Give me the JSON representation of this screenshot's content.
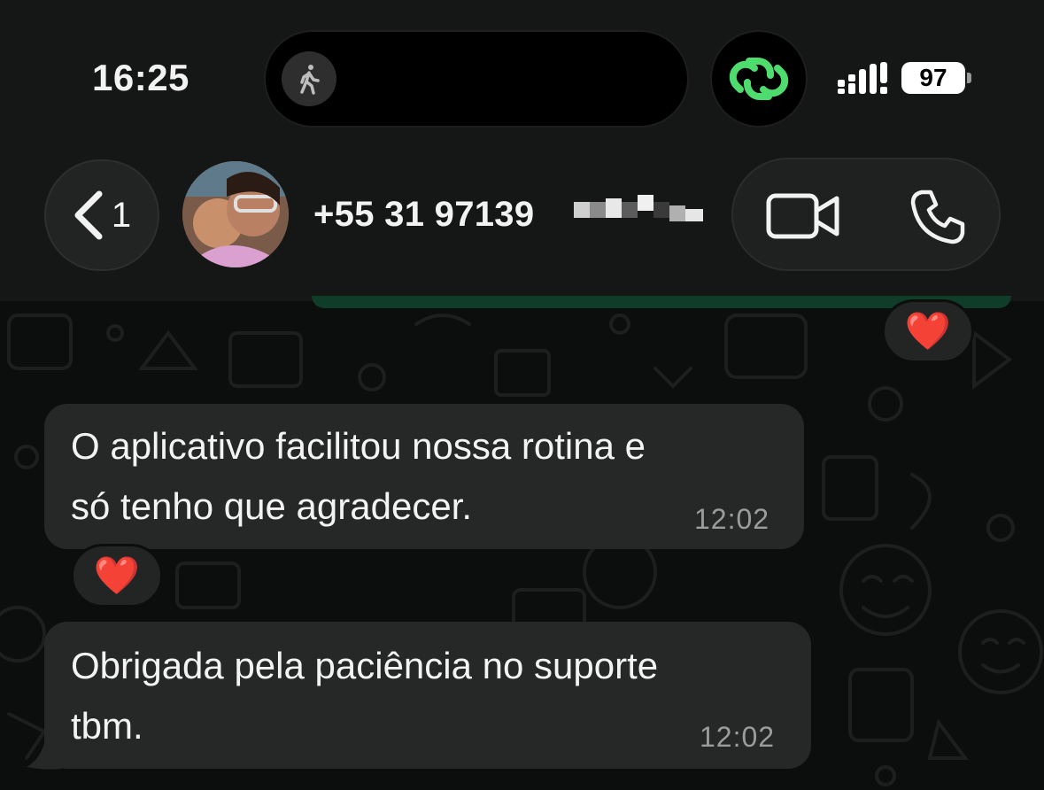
{
  "status_bar": {
    "time": "16:25",
    "activity_icon": "walking-person-icon",
    "link_icon": "link-icon",
    "signal_icon": "signal-bars-icon",
    "battery": "97"
  },
  "header": {
    "back_count": "1",
    "contact_name": "+55 31 97139",
    "video_icon": "video-camera-icon",
    "phone_icon": "phone-icon"
  },
  "messages": [
    {
      "text_line1": "O aplicativo facilitou nossa rotina e",
      "text_line2": "só tenho que  agradecer.",
      "time": "12:02",
      "reaction": "❤️"
    },
    {
      "text_line1": "Obrigada pela paciência no suporte",
      "text_line2": "tbm.",
      "time": "12:02"
    }
  ],
  "top_reaction": "❤️",
  "colors": {
    "header_bg": "#151616",
    "chat_bg": "#0c0d0d",
    "bubble_bg": "#262727",
    "accent_green": "#4fdc6e"
  }
}
